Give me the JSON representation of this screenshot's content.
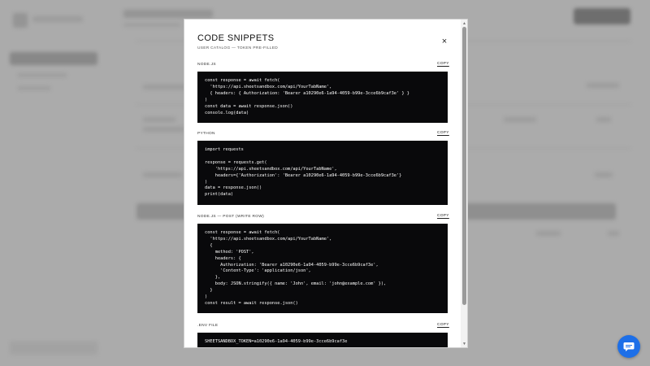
{
  "modal": {
    "title": "CODE SNIPPETS",
    "subtitle": "USER CATALOG — TOKEN PRE-FILLED",
    "close_glyph": "×",
    "sections": [
      {
        "label": "NODE.JS",
        "copy_label": "COPY",
        "code": "const response = await fetch(\n  'https://api.sheetsandbox.com/api/YourTabName',\n  { headers: { Authorization: 'Bearer a10290e6-1a94-4059-b99e-3cce6b9caf3e' } }\n)\nconst data = await response.json()\nconsole.log(data)"
      },
      {
        "label": "PYTHON",
        "copy_label": "COPY",
        "code": "import requests\n\nresponse = requests.get(\n    'https://api.sheetsandbox.com/api/YourTabName',\n    headers={'Authorization': 'Bearer a10290e6-1a94-4059-b99e-3cce6b9caf3e'}\n)\ndata = response.json()\nprint(data)"
      },
      {
        "label": "NODE.JS — POST (WRITE ROW)",
        "copy_label": "COPY",
        "code": "const response = await fetch(\n  'https://api.sheetsandbox.com/api/YourTabName',\n  {\n    method: 'POST',\n    headers: {\n      Authorization: 'Bearer a10290e6-1a94-4059-b99e-3cce6b9caf3e',\n      'Content-Type': 'application/json',\n    },\n    body: JSON.stringify({ name: 'John', email: 'john@example.com' }),\n  }\n)\nconst result = await response.json()"
      },
      {
        "label": ".ENV FILE",
        "copy_label": "COPY",
        "code": "SHEETSANDBOX_TOKEN=a10290e6-1a94-4059-b99e-3cce6b9caf3e"
      }
    ]
  },
  "scrollbar": {
    "up_glyph": "▲",
    "down_glyph": "▼"
  },
  "icons": {
    "close": "close-icon",
    "chat": "chat-bubble-icon"
  },
  "colors": {
    "code_bg": "#09090b",
    "chat_accent": "#1d6fe8",
    "overlay": "rgba(70,70,70,0.42)"
  }
}
